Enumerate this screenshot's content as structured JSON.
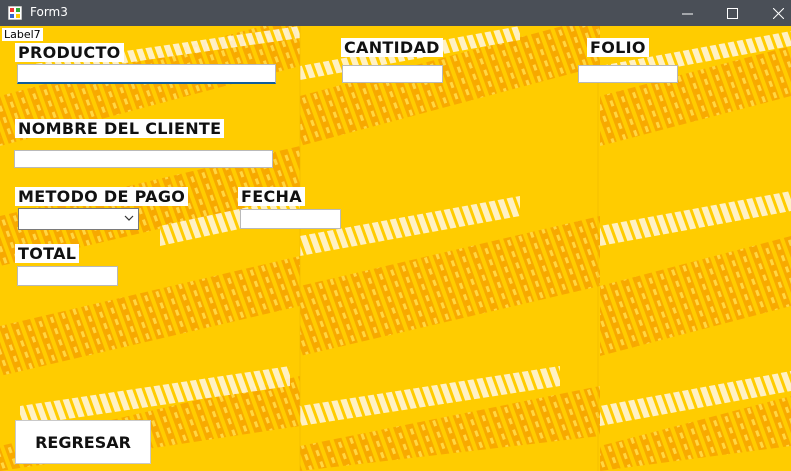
{
  "window": {
    "title": "Form3",
    "icon": "winforms-app-icon"
  },
  "controls": {
    "minimize": "minimize-icon",
    "maximize": "maximize-icon",
    "close": "close-icon"
  },
  "label7": "Label7",
  "fields": {
    "producto": {
      "label": "PRODUCTO",
      "value": ""
    },
    "cantidad": {
      "label": "CANTIDAD",
      "value": ""
    },
    "folio": {
      "label": "FOLIO",
      "value": ""
    },
    "cliente": {
      "label": "NOMBRE DEL CLIENTE",
      "value": ""
    },
    "metodo": {
      "label": "METODO DE PAGO",
      "value": ""
    },
    "fecha": {
      "label": "FECHA",
      "value": ""
    },
    "total": {
      "label": "TOTAL",
      "value": ""
    }
  },
  "regresar_label": "REGRESAR",
  "colors": {
    "background": "#ffcc00",
    "titlebar": "#4a4f57",
    "tread": "#f5a300",
    "focus": "#0f5d9c"
  }
}
